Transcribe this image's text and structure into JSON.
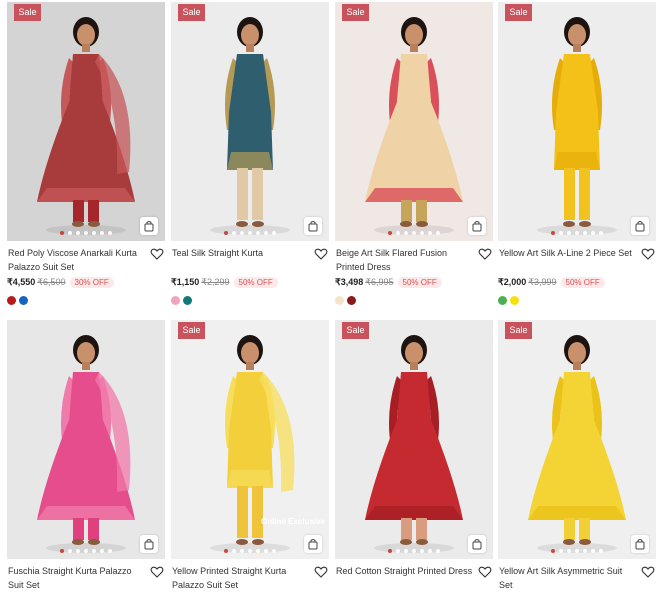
{
  "products": [
    {
      "name": "Red Poly Viscose Anarkali Kurta Palazzo Suit Set",
      "price": "₹4,550",
      "mrp": "₹6,500",
      "discount": "30% OFF",
      "badge": "Sale",
      "overlay": "",
      "swatches": [
        "#b71c1c",
        "#1565c0"
      ],
      "bg": "#d4d4d4",
      "garment": "#a83b3b",
      "garment2": "#c5585a",
      "bottom": "#a5272c"
    },
    {
      "name": "Teal Silk Straight Kurta",
      "price": "₹1,150",
      "mrp": "₹2,299",
      "discount": "50% OFF",
      "badge": "Sale",
      "overlay": "",
      "swatches": [
        "#f1a5bd",
        "#0f7a78"
      ],
      "bg": "#ececec",
      "garment": "#2f5e6e",
      "garment2": "#b49a55",
      "bottom": "#e2c9a6"
    },
    {
      "name": "Beige Art Silk Flared Fusion Printed Dress",
      "price": "₹3,498",
      "mrp": "₹6,995",
      "discount": "50% OFF",
      "badge": "Sale",
      "overlay": "",
      "swatches": [
        "#f3e6c8",
        "#8b1a1a"
      ],
      "bg": "#efe8e5",
      "garment": "#efd3a7",
      "garment2": "#d94f5a",
      "bottom": "#c6a55a"
    },
    {
      "name": "Yellow Art Silk A-Line 2 Piece Set",
      "price": "₹2,000",
      "mrp": "₹3,999",
      "discount": "50% OFF",
      "badge": "Sale",
      "overlay": "",
      "swatches": [
        "#4caf50",
        "#f5e10f"
      ],
      "bg": "#ededed",
      "garment": "#f3c118",
      "garment2": "#e6ad0a",
      "bottom": "#f2c21f"
    },
    {
      "name": "Fuschia Straight Kurta Palazzo Suit Set",
      "price": "",
      "mrp": "",
      "discount": "",
      "badge": "",
      "overlay": "",
      "swatches": [],
      "bg": "#e7e7e7",
      "garment": "#e54d8c",
      "garment2": "#f07aa9",
      "bottom": "#e0407d"
    },
    {
      "name": "Yellow Printed Straight Kurta Palazzo Suit Set",
      "price": "",
      "mrp": "",
      "discount": "",
      "badge": "Sale",
      "overlay": "Online Exclusive",
      "swatches": [],
      "bg": "#f0f0f0",
      "garment": "#f2cf3b",
      "garment2": "#f7dd5c",
      "bottom": "#efc43a"
    },
    {
      "name": "Red Cotton Straight Printed Dress",
      "price": "",
      "mrp": "",
      "discount": "",
      "badge": "Sale",
      "overlay": "",
      "swatches": [],
      "bg": "#ebebeb",
      "garment": "#c42a2f",
      "garment2": "#a71e24",
      "bottom": "#d99c7e"
    },
    {
      "name": "Yellow Art Silk Asymmetric Suit Set",
      "price": "",
      "mrp": "",
      "discount": "",
      "badge": "Sale",
      "overlay": "",
      "swatches": [],
      "bg": "#efefef",
      "garment": "#f4d335",
      "garment2": "#eac21a",
      "bottom": "#f1cf35"
    }
  ]
}
